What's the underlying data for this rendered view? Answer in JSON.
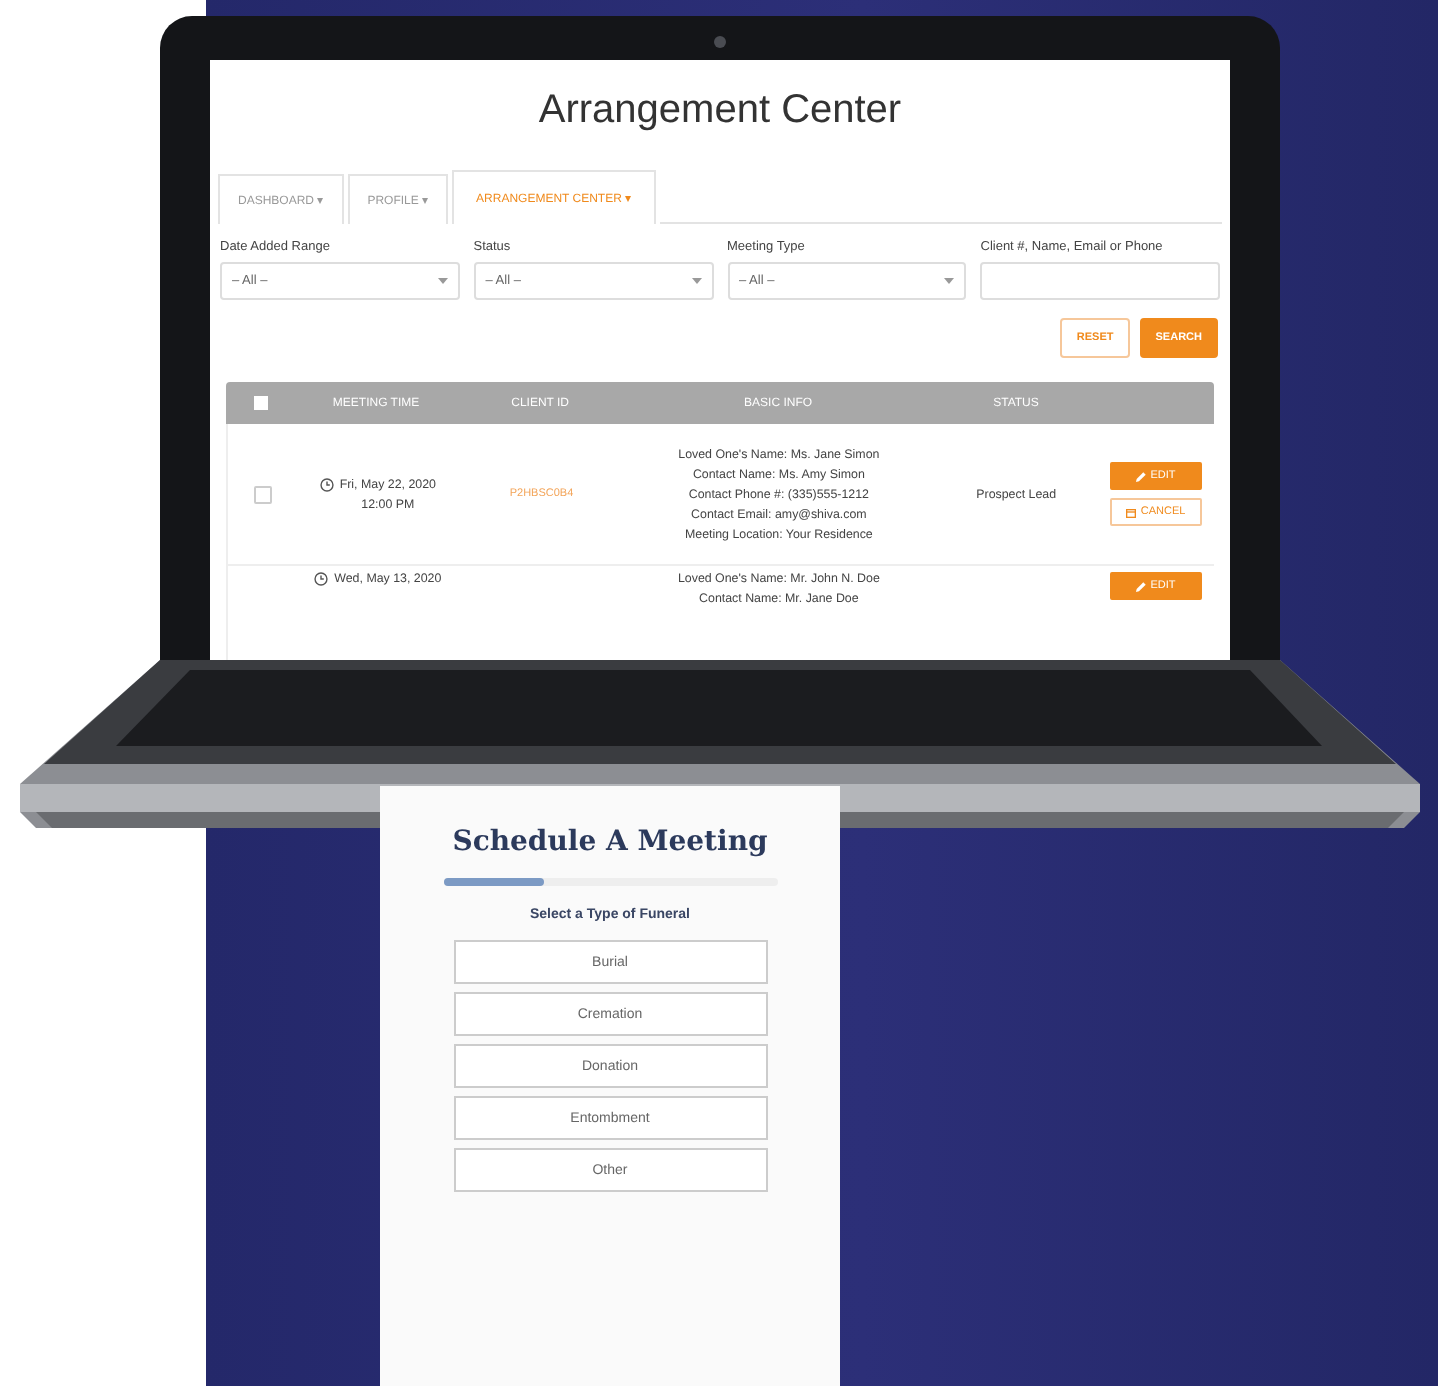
{
  "screen": {
    "title": "Arrangement Center",
    "tabs": [
      {
        "label": "DASHBOARD",
        "caret": "▾",
        "selected": false
      },
      {
        "label": "PROFILE",
        "caret": "▾",
        "selected": false
      },
      {
        "label": "ARRANGEMENT CENTER",
        "caret": "▾",
        "selected": true
      }
    ],
    "filters": [
      {
        "label": "Date Added Range",
        "kind": "select",
        "value": "– All –"
      },
      {
        "label": "Status",
        "kind": "select",
        "value": "– All –"
      },
      {
        "label": "Meeting Type",
        "kind": "select",
        "value": "– All –"
      },
      {
        "label": "Client #, Name, Email or Phone",
        "kind": "text"
      }
    ],
    "buttons": [
      {
        "label": "RESET",
        "kind": "outline"
      },
      {
        "label": "SEARCH",
        "kind": "solid"
      }
    ],
    "table": {
      "header_checked": false,
      "columns": [
        "MEETING TIME",
        "CLIENT ID",
        "BASIC INFO",
        "STATUS"
      ],
      "rows": [
        {
          "checked": false,
          "meeting_time": [
            "Fri, May 22, 2020",
            "12:00 PM"
          ],
          "client_id": "P2HBSC0B4",
          "basic_info": [
            "Loved One's Name: Ms. Jane Simon",
            "Contact Name: Ms. Amy Simon",
            "Contact Phone #: (335)555-1212",
            "Contact Email: amy@shiva.com",
            "Meeting Location: Your Residence"
          ],
          "status": "Prospect Lead",
          "actions": [
            {
              "label": "EDIT",
              "kind": "edit"
            },
            {
              "label": "CANCEL",
              "kind": "cancel"
            }
          ]
        },
        {
          "meeting_time": [
            "Wed, May 13, 2020"
          ],
          "basic_info": [
            "Loved One's Name: Mr. John N. Doe",
            "Contact Name: Mr. Jane Doe"
          ],
          "actions": [
            {
              "label": "EDIT",
              "kind": "edit"
            }
          ]
        }
      ]
    }
  },
  "card": {
    "title": "Schedule A Meeting",
    "progress": {
      "level": 0.3
    },
    "prompt": "Select a Type of Funeral",
    "options": [
      "Burial",
      "Cremation",
      "Donation",
      "Entombment",
      "Other"
    ]
  }
}
